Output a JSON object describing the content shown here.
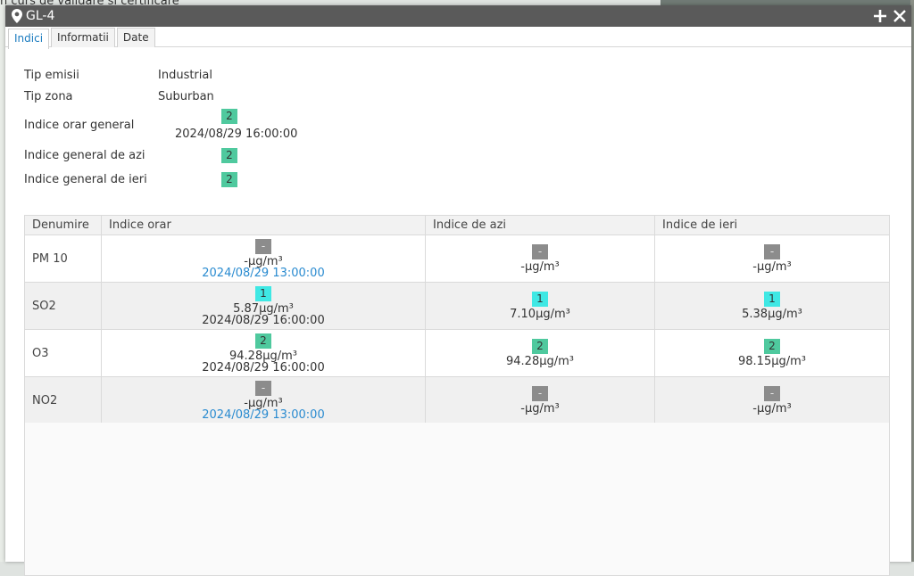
{
  "background": {
    "top_text": "n curs de validare si certificare"
  },
  "window": {
    "title": "GL-4",
    "actions": [
      "+",
      "×"
    ]
  },
  "tabs": [
    {
      "label": "Indici",
      "active": true
    },
    {
      "label": "Informatii",
      "active": false
    },
    {
      "label": "Date",
      "active": false
    }
  ],
  "info": {
    "tip_emisii_label": "Tip emisii",
    "tip_emisii_value": "Industrial",
    "tip_zona_label": "Tip zona",
    "tip_zona_value": "Suburban",
    "orar_label": "Indice orar general",
    "orar_badge": "2",
    "orar_time": "2024/08/29 16:00:00",
    "azi_label": "Indice general de azi",
    "azi_badge": "2",
    "ieri_label": "Indice general de ieri",
    "ieri_badge": "2"
  },
  "colors": {
    "index_1": "#3fe8e4",
    "index_2": "#4fc99e",
    "no_data": "#8c8c8c",
    "link": "#2a8bd0"
  },
  "table": {
    "headers": [
      "Denumire",
      "Indice orar",
      "Indice de azi",
      "Indice de ieri"
    ],
    "rows": [
      {
        "name": "PM 10",
        "orar": {
          "badge": "-",
          "value": "-µg/m³",
          "time": "2024/08/29 13:00:00"
        },
        "azi": {
          "badge": "-",
          "value": "-µg/m³"
        },
        "ieri": {
          "badge": "-",
          "value": "-µg/m³"
        }
      },
      {
        "name": "SO2",
        "orar": {
          "badge": "1",
          "value": "5.87µg/m³",
          "time": "2024/08/29 16:00:00"
        },
        "azi": {
          "badge": "1",
          "value": "7.10µg/m³"
        },
        "ieri": {
          "badge": "1",
          "value": "5.38µg/m³"
        }
      },
      {
        "name": "O3",
        "orar": {
          "badge": "2",
          "value": "94.28µg/m³",
          "time": "2024/08/29 16:00:00"
        },
        "azi": {
          "badge": "2",
          "value": "94.28µg/m³"
        },
        "ieri": {
          "badge": "2",
          "value": "98.15µg/m³"
        }
      },
      {
        "name": "NO2",
        "orar": {
          "badge": "-",
          "value": "-µg/m³",
          "time": "2024/08/29 13:00:00"
        },
        "azi": {
          "badge": "-",
          "value": "-µg/m³"
        },
        "ieri": {
          "badge": "-",
          "value": "-µg/m³"
        }
      }
    ]
  }
}
